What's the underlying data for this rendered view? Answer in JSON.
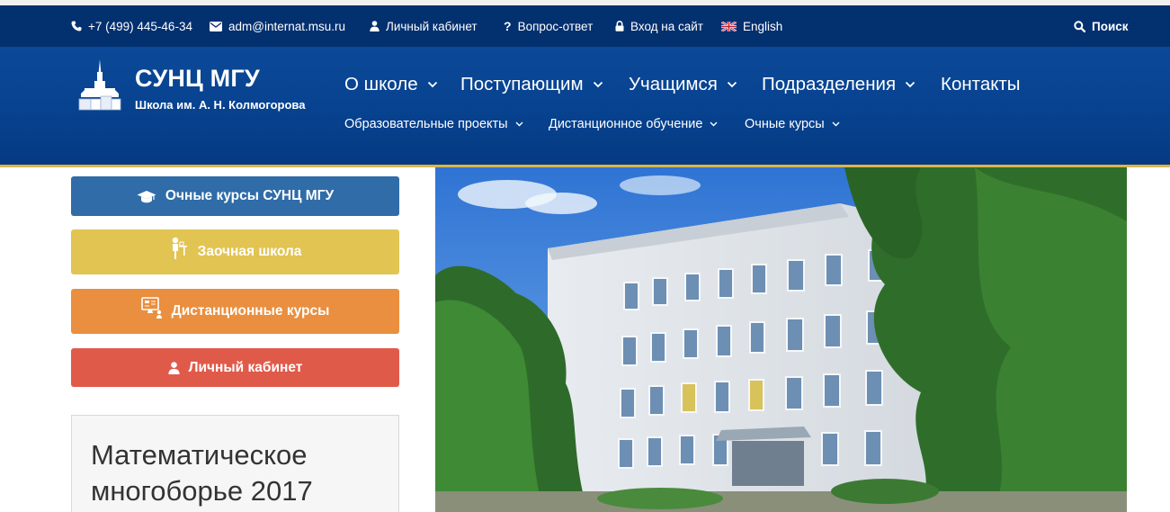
{
  "topbar": {
    "phone": "+7 (499) 445-46-34",
    "email": "adm@internat.msu.ru",
    "cabinet": "Личный кабинет",
    "faq": "Вопрос-ответ",
    "login": "Вход на сайт",
    "language": "English",
    "search": "Поиск"
  },
  "logo": {
    "title": "СУНЦ МГУ",
    "subtitle": "Школа им. А. Н. Колмогорова"
  },
  "nav": {
    "main": [
      "О школе",
      "Поступающим",
      "Учащимся",
      "Подразделения",
      "Контакты"
    ],
    "sub": [
      "Образовательные проекты",
      "Дистанционное обучение",
      "Очные курсы"
    ]
  },
  "sidebar": {
    "buttons": [
      {
        "label": "Очные курсы СУНЦ МГУ",
        "icon": "graduation-cap-icon",
        "color": "#2f6ca8"
      },
      {
        "label": "Заочная школа",
        "icon": "student-desk-icon",
        "color": "#e2c453"
      },
      {
        "label": "Дистанционные курсы",
        "icon": "monitor-teacher-icon",
        "color": "#e98f3f"
      },
      {
        "label": "Личный кабинет",
        "icon": "user-icon",
        "color": "#e05a4a"
      }
    ],
    "panel_title": "Математическое многоборье 2017"
  },
  "colors": {
    "topbar": "#03306f",
    "header": "#0b4998",
    "accent_gold": "#d9b64a"
  }
}
